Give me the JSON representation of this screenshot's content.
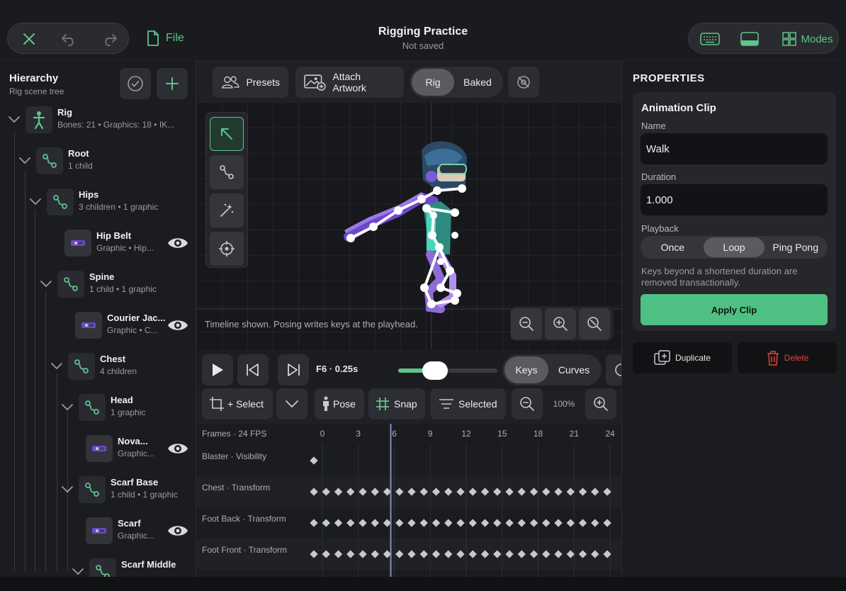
{
  "header": {
    "title": "Rigging Practice",
    "subtitle": "Not saved",
    "file_label": "File",
    "modes_label": "Modes",
    "accent": "#5ec48c"
  },
  "hierarchy": {
    "title": "Hierarchy",
    "subtitle": "Rig scene tree",
    "nodes": [
      {
        "name": "Rig",
        "sub": "Bones: 21  •  Graphics: 18  •  IK...",
        "icon": "figure-icon"
      },
      {
        "name": "Root",
        "sub": "1 child",
        "icon": "bone-icon"
      },
      {
        "name": "Hips",
        "sub": "3 children  •  1 graphic",
        "icon": "bone-icon"
      },
      {
        "name": "Hip Belt",
        "sub": "Graphic  •  Hip...",
        "icon": "graphic-thumb"
      },
      {
        "name": "Spine",
        "sub": "1 child  •  1 graphic",
        "icon": "bone-icon"
      },
      {
        "name": "Courier Jac...",
        "sub": "Graphic  •  C...",
        "icon": "graphic-thumb"
      },
      {
        "name": "Chest",
        "sub": "4 children",
        "icon": "bone-icon"
      },
      {
        "name": "Head",
        "sub": "1 graphic",
        "icon": "bone-icon"
      },
      {
        "name": "Nova...",
        "sub": "Graphic...",
        "icon": "graphic-thumb"
      },
      {
        "name": "Scarf Base",
        "sub": "1 child  •  1 graphic",
        "icon": "bone-icon"
      },
      {
        "name": "Scarf",
        "sub": "Graphic...",
        "icon": "graphic-thumb"
      },
      {
        "name": "Scarf Middle",
        "sub": "",
        "icon": "bone-icon"
      }
    ]
  },
  "toolbar": {
    "presets": "Presets",
    "attach": "Attach Artwork",
    "mode_rig": "Rig",
    "mode_baked": "Baked",
    "active_mode": "Rig"
  },
  "canvas": {
    "hint": "Timeline shown. Posing writes keys at the playhead."
  },
  "playback": {
    "frame_readout": "F6 · 0.25s",
    "keys": "Keys",
    "curves": "Curves",
    "scrub_progress": 0.3
  },
  "controls": {
    "select": "+ Select",
    "pose": "Pose",
    "snap": "Snap",
    "selected": "Selected",
    "zoom": "100%"
  },
  "timeline": {
    "header": "Frames · 24 FPS",
    "ticks": [
      "0",
      "3",
      "6",
      "9",
      "12",
      "15",
      "18",
      "21",
      "24"
    ],
    "playhead_frame": 6,
    "tracks": [
      {
        "name": "Blaster · Visibility",
        "keys": [
          0
        ]
      },
      {
        "name": "Chest · Transform",
        "keys": [
          0,
          1,
          2,
          3,
          4,
          5,
          6,
          7,
          8,
          9,
          10,
          11,
          12,
          13,
          14,
          15,
          16,
          17,
          18,
          19,
          20,
          21,
          22,
          23,
          24
        ]
      },
      {
        "name": "Foot Back · Transform",
        "keys": [
          0,
          1,
          2,
          3,
          4,
          5,
          6,
          7,
          8,
          9,
          10,
          11,
          12,
          13,
          14,
          15,
          16,
          17,
          18,
          19,
          20,
          21,
          22,
          23,
          24
        ]
      },
      {
        "name": "Foot Front · Transform",
        "keys": [
          0,
          1,
          2,
          3,
          4,
          5,
          6,
          7,
          8,
          9,
          10,
          11,
          12,
          13,
          14,
          15,
          16,
          17,
          18,
          19,
          20,
          21,
          22,
          23,
          24
        ]
      }
    ]
  },
  "properties": {
    "title": "PROPERTIES",
    "section": "Animation Clip",
    "name_label": "Name",
    "name_value": "Walk",
    "duration_label": "Duration",
    "duration_value": "1.000",
    "playback_label": "Playback",
    "playback_options": [
      "Once",
      "Loop",
      "Ping Pong"
    ],
    "playback_selected": "Loop",
    "note": "Keys beyond a shortened duration are removed transactionally.",
    "apply": "Apply Clip",
    "duplicate": "Duplicate",
    "delete": "Delete",
    "delete_color": "#e0453a"
  }
}
